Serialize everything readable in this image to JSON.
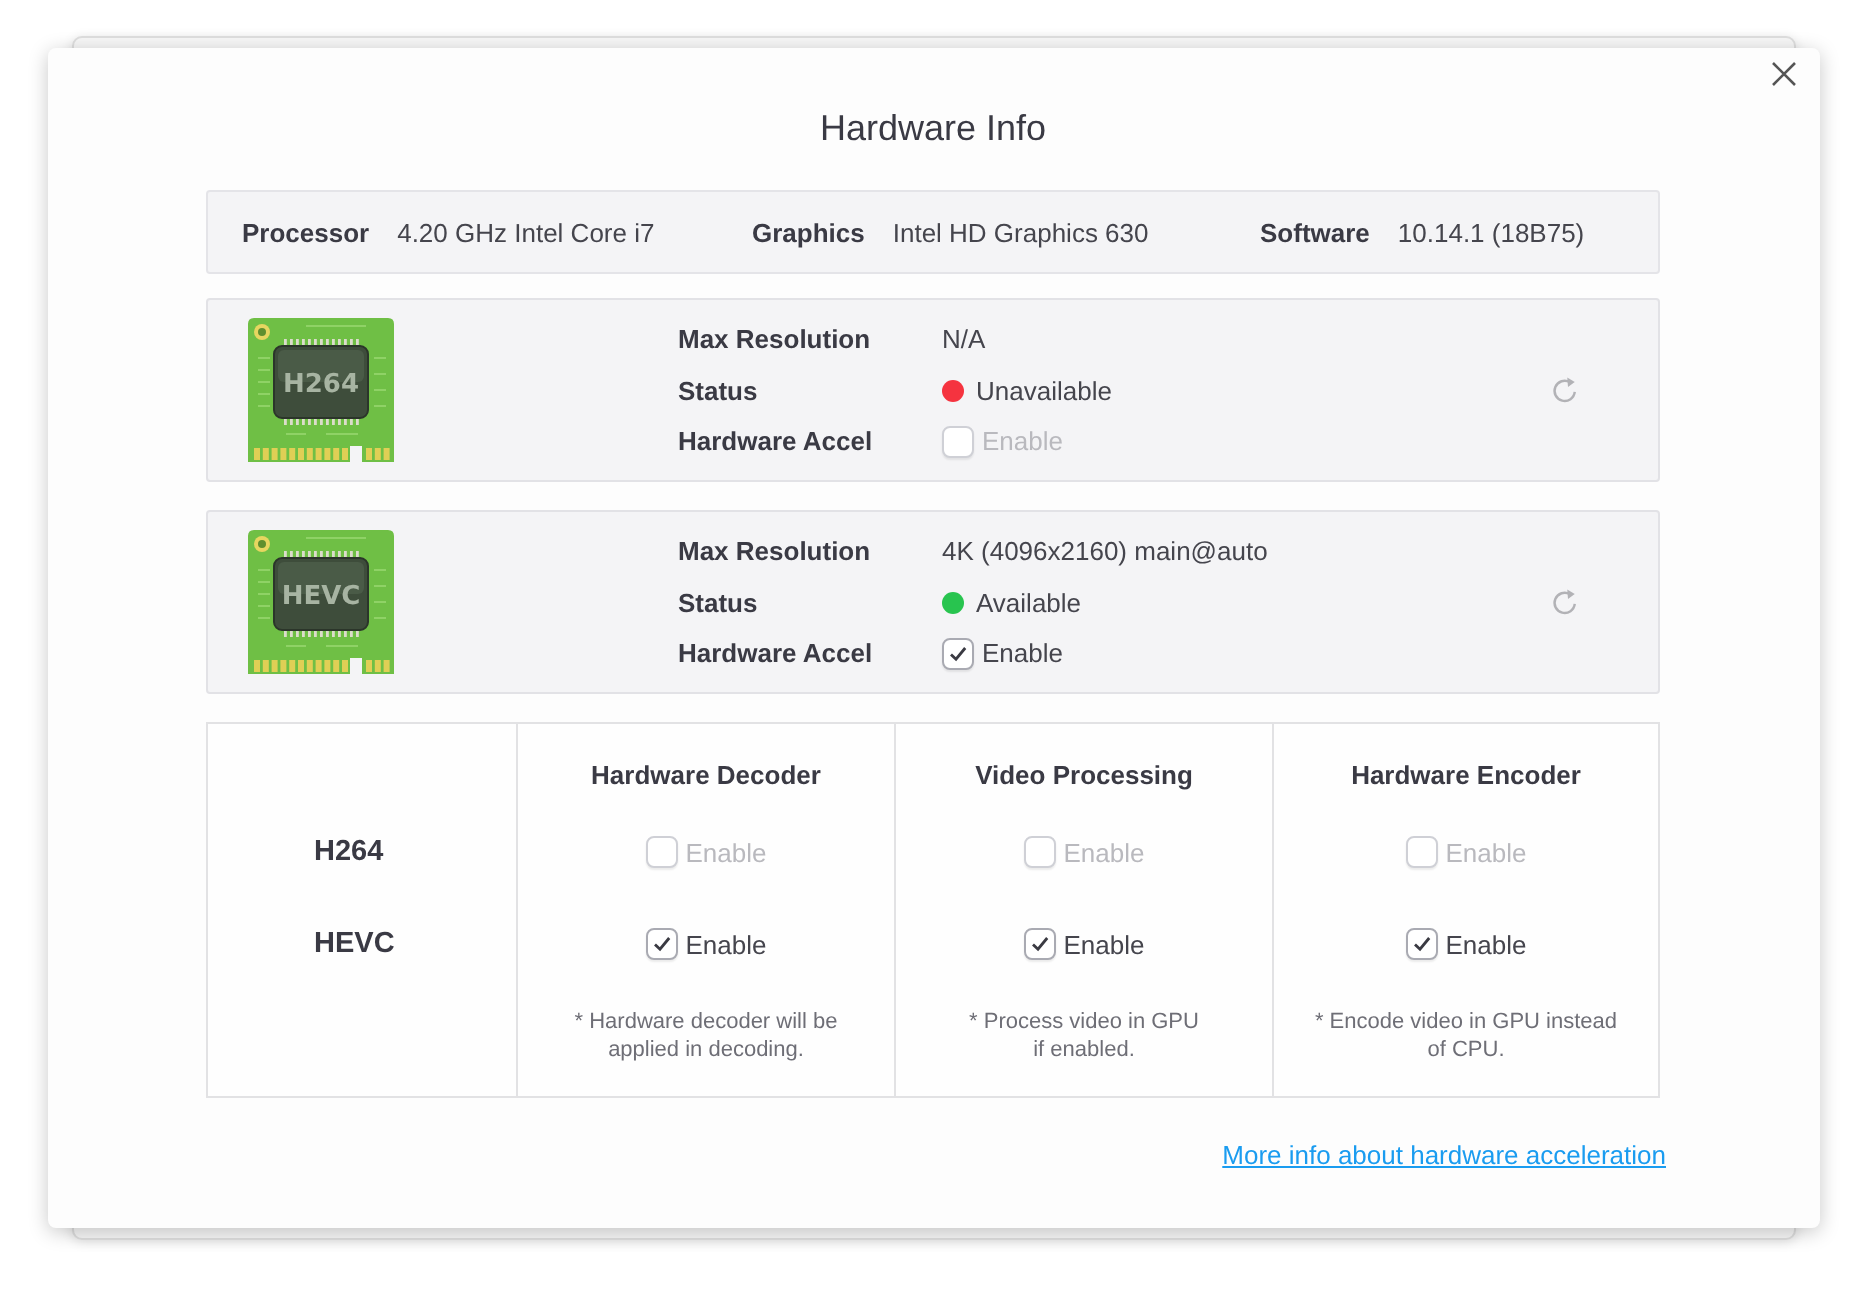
{
  "window": {
    "title": "Hardware Info"
  },
  "summary": [
    {
      "label": "Processor",
      "value": "4.20 GHz Intel Core i7"
    },
    {
      "label": "Graphics",
      "value": "Intel HD Graphics 630"
    },
    {
      "label": "Software",
      "value": "10.14.1 (18B75)"
    }
  ],
  "codecs": [
    {
      "chip_label": "H264",
      "rows": [
        {
          "kind": "text",
          "label": "Max Resolution",
          "value": "N/A"
        },
        {
          "kind": "status",
          "label": "Status",
          "value": "Unavailable",
          "color": "#f5333f"
        },
        {
          "kind": "checkbox",
          "label": "Hardware Accel",
          "value": "Enable",
          "checked": false,
          "disabled": true
        }
      ]
    },
    {
      "chip_label": "HEVC",
      "rows": [
        {
          "kind": "text",
          "label": "Max Resolution",
          "value": "4K (4096x2160) main@auto"
        },
        {
          "kind": "status",
          "label": "Status",
          "value": "Available",
          "color": "#28c44f"
        },
        {
          "kind": "checkbox",
          "label": "Hardware Accel",
          "value": "Enable",
          "checked": true,
          "disabled": false
        }
      ]
    }
  ],
  "capabilities": {
    "columns": [
      "Hardware Decoder",
      "Video Processing",
      "Hardware Encoder"
    ],
    "rows": [
      {
        "label": "H264",
        "cells": [
          {
            "text": "Enable",
            "checked": false,
            "disabled": true
          },
          {
            "text": "Enable",
            "checked": false,
            "disabled": true
          },
          {
            "text": "Enable",
            "checked": false,
            "disabled": true
          }
        ]
      },
      {
        "label": "HEVC",
        "cells": [
          {
            "text": "Enable",
            "checked": true,
            "disabled": false
          },
          {
            "text": "Enable",
            "checked": true,
            "disabled": false
          },
          {
            "text": "Enable",
            "checked": true,
            "disabled": false
          }
        ]
      }
    ],
    "notes": [
      "* Hardware decoder will be\napplied in decoding.",
      "* Process video in GPU\nif enabled.",
      "* Encode video in GPU instead\nof CPU."
    ]
  },
  "link": {
    "text": "More info about hardware acceleration"
  }
}
